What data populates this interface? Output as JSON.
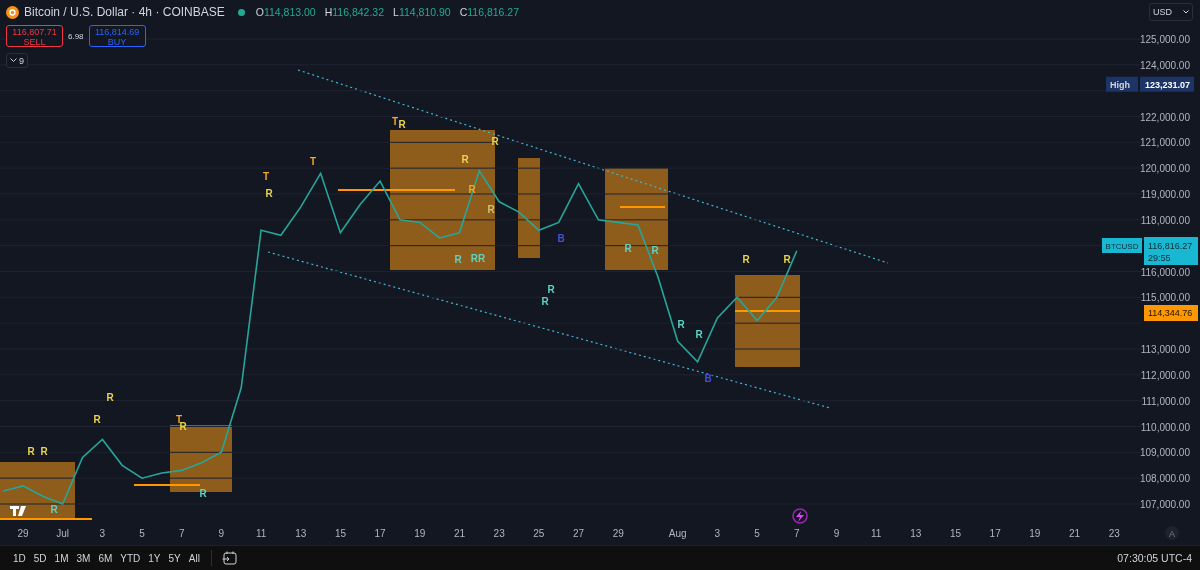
{
  "header": {
    "symbol_title": "Bitcoin / U.S. Dollar · 4h · COINBASE",
    "market_open": true,
    "ohlc": [
      {
        "label": "O",
        "value": "114,813.00"
      },
      {
        "label": "H",
        "value": "116,842.32"
      },
      {
        "label": "L",
        "value": "114,810.90"
      },
      {
        "label": "C",
        "value": "116,816.27"
      }
    ]
  },
  "trade": {
    "sell": {
      "price": "116,807.71",
      "label": "SELL"
    },
    "spread": "6.98",
    "buy": {
      "price": "116,814.69",
      "label": "BUY"
    }
  },
  "indicators_toggle": {
    "count": "9"
  },
  "currency": {
    "value": "USD"
  },
  "chart": {
    "high_marker": {
      "label": "High",
      "value": "123,231.07"
    },
    "last_price": "116,816.27",
    "countdown": "29:55",
    "level_tag": "114,344.76",
    "auto_scale": "A",
    "chart_data": {
      "type": "line",
      "grid": true,
      "categories": [
        null,
        "29",
        null,
        "Jul",
        null,
        "3",
        null,
        "5",
        null,
        "7",
        null,
        "9",
        null,
        "11",
        null,
        "13",
        null,
        "15",
        null,
        "17",
        null,
        "19",
        null,
        "21",
        null,
        "23",
        null,
        "25",
        null,
        "27",
        null,
        "29",
        null,
        null,
        "Aug",
        null,
        "3",
        null,
        "5",
        null,
        "7",
        null,
        "9",
        null,
        "11",
        null,
        "13",
        null,
        "15",
        null,
        "17",
        null,
        "19",
        null,
        "21",
        null,
        "23"
      ],
      "ylim": [
        107000,
        125000
      ],
      "series": [
        {
          "name": "BTCUSD",
          "color": "#26a69a",
          "values": [
            107500,
            107700,
            107300,
            107000,
            108800,
            109500,
            108500,
            108000,
            108200,
            108300,
            108600,
            109000,
            111500,
            117600,
            117400,
            118500,
            119800,
            117500,
            118600,
            119500,
            118000,
            117900,
            117300,
            117500,
            119900,
            118700,
            118300,
            117600,
            117900,
            119400,
            118000,
            117900,
            117800,
            115800,
            113300,
            112500,
            114200,
            115000,
            114100,
            115000,
            116800,
            null,
            null,
            null,
            null,
            null,
            null,
            null,
            null,
            null,
            null,
            null,
            null,
            null,
            null,
            null,
            null
          ]
        }
      ],
      "yticks": [
        {
          "value": 125000,
          "label": "125,000.00"
        },
        {
          "value": 124000,
          "label": "124,000.00"
        },
        {
          "value": 122000,
          "label": "122,000.00"
        },
        {
          "value": 121000,
          "label": "121,000.00"
        },
        {
          "value": 120000,
          "label": "120,000.00"
        },
        {
          "value": 119000,
          "label": "119,000.00"
        },
        {
          "value": 118000,
          "label": "118,000.00"
        },
        {
          "value": 116000,
          "label": "116,000.00"
        },
        {
          "value": 115000,
          "label": "115,000.00"
        },
        {
          "value": 113000,
          "label": "113,000.00"
        },
        {
          "value": 112000,
          "label": "112,000.00"
        },
        {
          "value": 111000,
          "label": "111,000.00"
        },
        {
          "value": 110000,
          "label": "110,000.00"
        },
        {
          "value": 109000,
          "label": "109,000.00"
        },
        {
          "value": 108000,
          "label": "108,000.00"
        },
        {
          "value": 107000,
          "label": "107,000.00"
        }
      ]
    }
  },
  "signals": [
    {
      "text": "R",
      "color": "#e8d44d"
    },
    {
      "text": "R",
      "color": "#e8d44d"
    },
    {
      "text": "R",
      "color": "#5ed3c3"
    },
    {
      "text": "R",
      "color": "#e8d44d"
    },
    {
      "text": "R",
      "color": "#e8d44d"
    },
    {
      "text": "T",
      "color": "#f5a623"
    },
    {
      "text": "R",
      "color": "#e8d44d"
    },
    {
      "text": "R",
      "color": "#5ed3c3"
    },
    {
      "text": "T",
      "color": "#f5a623"
    },
    {
      "text": "R",
      "color": "#e8d44d"
    },
    {
      "text": "T",
      "color": "#f5a623"
    },
    {
      "text": "T",
      "color": "#f5a623"
    },
    {
      "text": "R",
      "color": "#e8d44d"
    },
    {
      "text": "R",
      "color": "#e8d44d"
    },
    {
      "text": "R",
      "color": "#f5a623"
    },
    {
      "text": "R",
      "color": "#e8d44d"
    },
    {
      "text": "R",
      "color": "#c8c86a"
    },
    {
      "text": "R",
      "color": "#5ed3c3"
    },
    {
      "text": "RR",
      "color": "#5ed3c3"
    },
    {
      "text": "R",
      "color": "#5ed3c3"
    },
    {
      "text": "R",
      "color": "#5ed3c3"
    },
    {
      "text": "B",
      "color": "#3f51d8"
    },
    {
      "text": "R",
      "color": "#5ed3c3"
    },
    {
      "text": "R",
      "color": "#5ed3c3"
    },
    {
      "text": "R",
      "color": "#5ed3c3"
    },
    {
      "text": "R",
      "color": "#5ed3c3"
    },
    {
      "text": "B",
      "color": "#3f51d8"
    },
    {
      "text": "R",
      "color": "#e8d44d"
    },
    {
      "text": "R",
      "color": "#e8d44d"
    }
  ],
  "range_buttons": [
    "1D",
    "5D",
    "1M",
    "3M",
    "6M",
    "YTD",
    "1Y",
    "5Y",
    "All"
  ],
  "clock": "07:30:05 UTC-4"
}
